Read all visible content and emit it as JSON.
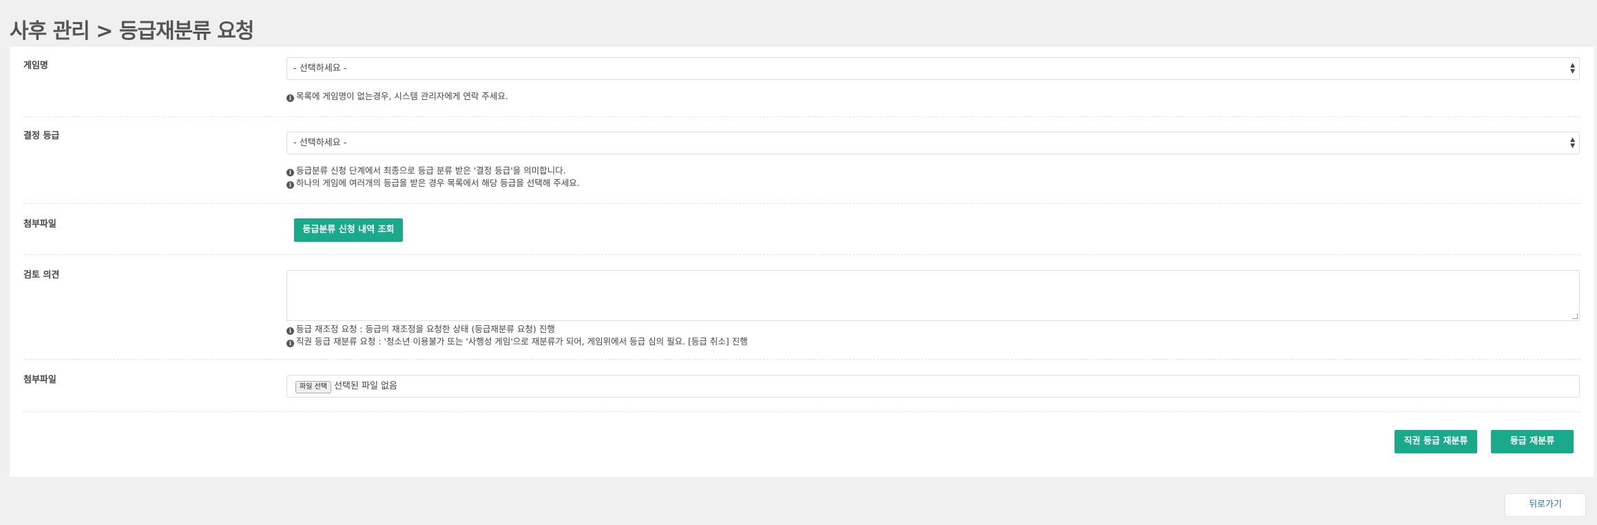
{
  "page": {
    "title": "사후 관리 > 등급재분류 요청"
  },
  "game": {
    "label": "게임명",
    "select_value": "- 선택하세요 -",
    "hint": "목록에 게임명이 없는경우, 시스템 관리자에게 연락 주세요."
  },
  "decision": {
    "label": "결정 등급",
    "select_value": "- 선택하세요 -",
    "hints": [
      "등급분류 신청 단계에서 최종으로 등급 분류 받은 '결정 등급'을 의미합니다.",
      "하나의 게임에 여러개의 등급을 받은 경우 목록에서 해당 등급을 선택해 주세요."
    ]
  },
  "attachment_lookup": {
    "label": "첨부파일",
    "button_label": "등급분류 신청 내역 조회"
  },
  "review": {
    "label": "검토 의견",
    "value": "",
    "hints": [
      "등급 재조정 요청 : 등급의 재조정을 요청한 상태 (등급재분류 요청) 진행",
      "직권 등급 재분류 요청 : '청소년 이용불가 또는 '사행성 게임'으로 재분류가 되어, 게임위에서 등급 심의 필요. [등급 취소] 진행"
    ]
  },
  "file_upload": {
    "label": "첨부파일",
    "button_label": "파일 선택",
    "status": "선택된 파일 없음"
  },
  "actions": {
    "official_button": "직권 등급 재분류",
    "reclassify_button": "등급 재분류",
    "back_button": "뒤로가기"
  },
  "colors": {
    "accent": "#1aa98a",
    "link": "#2a6fb5",
    "background": "#f0f0f0"
  },
  "icons": [
    "info-icon",
    "select-arrows-icon",
    "resize-handle-icon"
  ]
}
